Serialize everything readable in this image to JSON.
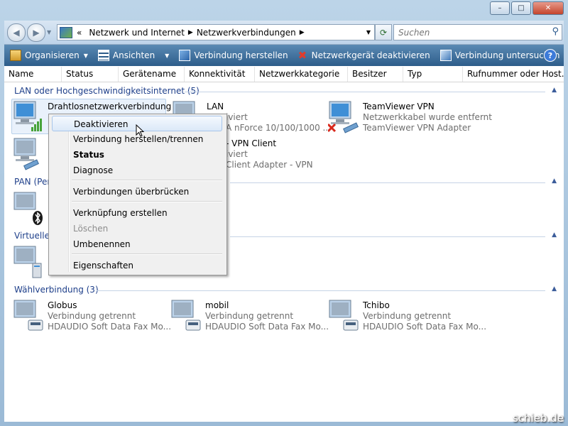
{
  "address": {
    "back_icon": "back-arrow-icon",
    "forward_icon": "forward-arrow-icon",
    "chevrons": "«",
    "crumbs": [
      "Netzwerk und Internet",
      "Netzwerkverbindungen"
    ]
  },
  "search": {
    "placeholder": "Suchen"
  },
  "toolbar": {
    "items": [
      {
        "label": "Organisieren",
        "icon": "organize-icon"
      },
      {
        "label": "Ansichten",
        "icon": "views-icon"
      },
      {
        "label": "Verbindung herstellen",
        "icon": "connect-icon"
      },
      {
        "label": "Netzwerkgerät deaktivieren",
        "icon": "disable-device-icon"
      },
      {
        "label": "Verbindung untersuchen",
        "icon": "diagnose-icon"
      }
    ],
    "more": "»",
    "help": "?"
  },
  "columns": [
    "Name",
    "Status",
    "Gerätename",
    "Konnektivität",
    "Netzwerkkategorie",
    "Besitzer",
    "Typ",
    "Rufnummer oder Host..."
  ],
  "groups": [
    {
      "title": "LAN oder Hochgeschwindigkeitsinternet (5)"
    },
    {
      "title": "PAN (Per"
    },
    {
      "title": "Virtuelles"
    },
    {
      "title": "Wählverbindung (3)"
    }
  ],
  "lan_items": [
    {
      "name": "Drahtlosnetzwerkverbindung",
      "status": "",
      "device": ""
    },
    {
      "name": "LAN",
      "status": "iviert",
      "device": "A nForce 10/100/1000 ..."
    },
    {
      "name": "TeamViewer VPN",
      "status": "Netzwerkkabel wurde entfernt",
      "device": "TeamViewer VPN Adapter"
    },
    {
      "name": "- VPN Client",
      "status": "iviert",
      "device": "Client Adapter - VPN"
    }
  ],
  "dial_items": [
    {
      "name": "Globus",
      "status": "Verbindung getrennt",
      "device": "HDAUDIO Soft Data Fax Mo..."
    },
    {
      "name": "mobil",
      "status": "Verbindung getrennt",
      "device": "HDAUDIO Soft Data Fax Mo..."
    },
    {
      "name": "Tchibo",
      "status": "Verbindung getrennt",
      "device": "HDAUDIO Soft Data Fax Mo..."
    }
  ],
  "context_menu": [
    {
      "label": "Deaktivieren",
      "state": "highlighted"
    },
    {
      "label": "Verbindung herstellen/trennen",
      "state": "normal"
    },
    {
      "label": "Status",
      "state": "bold"
    },
    {
      "label": "Diagnose",
      "state": "normal"
    },
    {
      "label": "Verbindungen überbrücken",
      "state": "normal"
    },
    {
      "label": "Verknüpfung erstellen",
      "state": "normal"
    },
    {
      "label": "Löschen",
      "state": "disabled"
    },
    {
      "label": "Umbenennen",
      "state": "normal"
    },
    {
      "label": "Eigenschaften",
      "state": "normal"
    }
  ],
  "window_buttons": {
    "minimize": "–",
    "maximize": "□",
    "close": "✕"
  },
  "watermark": "schieb.de",
  "colors": {
    "group_header": "#1e3f8a",
    "toolbar_dark": "#2e5d8a",
    "toolbar_light": "#5a8ab4",
    "menu_bg": "#f0f0f0"
  }
}
